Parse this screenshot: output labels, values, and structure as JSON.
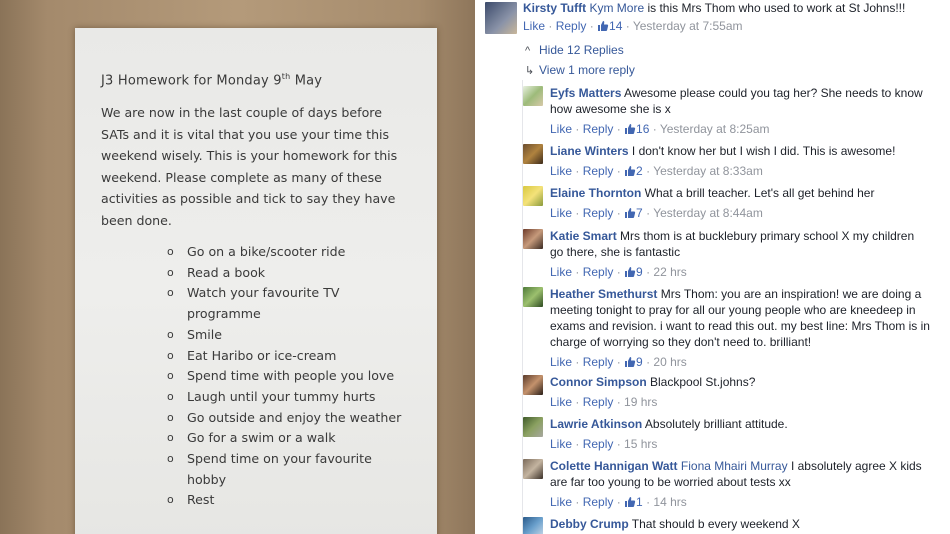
{
  "paper": {
    "title_main": "J3 Homework for Monday 9",
    "title_sup": "th",
    "title_end": "May",
    "body": "We are now in the last couple of days before SATs and it is vital that you use your time this weekend wisely. This is your homework for this weekend. Please complete as many of these activities as possible and tick to say they have been done.",
    "items": [
      "Go on a bike/scooter ride",
      "Read a book",
      "Watch your favourite TV programme",
      "Smile",
      "Eat Haribo or ice-cream",
      "Spend time with people you love",
      "Laugh until your tummy hurts",
      "Go outside and enjoy the weather",
      "Go for a swim or a walk",
      "Spend time on your favourite hobby",
      "Rest"
    ]
  },
  "thread": {
    "top_comment": {
      "author": "Kirsty Tufft",
      "mention": "Kym More",
      "text": " is this Mrs Thom who used to work at St Johns!!!",
      "like_label": "Like",
      "reply_label": "Reply",
      "likes": "14",
      "time": "Yesterday at 7:55am"
    },
    "hide_replies": "Hide 12 Replies",
    "view_more": "View 1 more reply",
    "replies": [
      {
        "author": "Eyfs Matters",
        "mention": "",
        "text": " Awesome please could you tag her? She needs to know how awesome she is x",
        "likes": "16",
        "time": "Yesterday at 8:25am",
        "like_label": "Like",
        "reply_label": "Reply"
      },
      {
        "author": "Liane Winters",
        "mention": "",
        "text": " I don't know her but I wish I did. This is awesome!",
        "likes": "2",
        "time": "Yesterday at 8:33am",
        "like_label": "Like",
        "reply_label": "Reply"
      },
      {
        "author": "Elaine Thornton",
        "mention": "",
        "text": " What a brill teacher. Let's all get behind her",
        "likes": "7",
        "time": "Yesterday at 8:44am",
        "like_label": "Like",
        "reply_label": "Reply"
      },
      {
        "author": "Katie Smart",
        "mention": "",
        "text": " Mrs thom is at bucklebury primary school X my children go there, she is fantastic",
        "likes": "9",
        "time": "22 hrs",
        "like_label": "Like",
        "reply_label": "Reply"
      },
      {
        "author": "Heather Smethurst",
        "mention": "",
        "text": " Mrs Thom: you are an inspiration! we are doing a meeting tonight to pray for all our young people who are kneedeep in exams and revision. i want to read this out. my best line: Mrs Thom is in charge of worrying so they don't need to. brilliant!",
        "likes": "9",
        "time": "20 hrs",
        "like_label": "Like",
        "reply_label": "Reply"
      },
      {
        "author": "Connor Simpson",
        "mention": "",
        "text": " Blackpool St.johns?",
        "likes": "",
        "time": "19 hrs",
        "like_label": "Like",
        "reply_label": "Reply"
      },
      {
        "author": "Lawrie Atkinson",
        "mention": "",
        "text": " Absolutely brilliant attitude.",
        "likes": "",
        "time": "15 hrs",
        "like_label": "Like",
        "reply_label": "Reply"
      },
      {
        "author": "Colette Hannigan Watt",
        "mention": "Fiona Mhairi Murray",
        "text": " I absolutely agree X kids are far too young to be worried about tests xx",
        "likes": "1",
        "time": "14 hrs",
        "like_label": "Like",
        "reply_label": "Reply"
      },
      {
        "author": "Debby Crump",
        "mention": "",
        "text": " That should b every weekend X",
        "likes": "",
        "time": "",
        "like_label": "Like",
        "reply_label": "Reply"
      }
    ]
  },
  "colors": {
    "link": "#365899",
    "action": "#4267b2",
    "muted": "#90949c"
  }
}
